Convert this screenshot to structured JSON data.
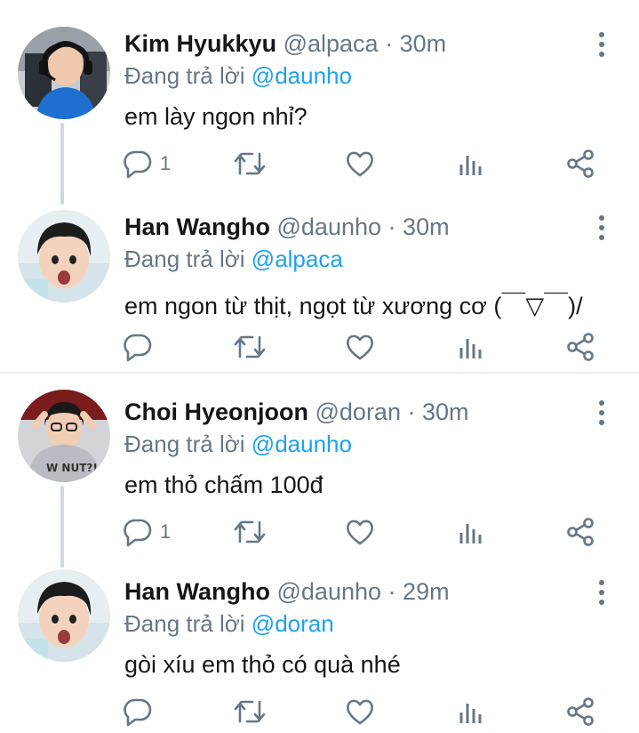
{
  "tweets": [
    {
      "name": "Kim Hyukkyu",
      "handle": "@alpaca",
      "time": "30m",
      "reply_prefix": "Đang trả lời",
      "reply_to": "@daunho",
      "text": "em lày ngon nhỉ?",
      "reply_count": "1",
      "avatar": "avatar-kim-hyukkyu"
    },
    {
      "name": "Han Wangho",
      "handle": "@daunho",
      "time": "30m",
      "reply_prefix": "Đang trả lời",
      "reply_to": "@alpaca",
      "text": "em ngon từ thịt, ngọt từ xương cơ (￣▽￣)/",
      "reply_count": "",
      "avatar": "avatar-han-wangho"
    },
    {
      "name": "Choi Hyeonjoon",
      "handle": "@doran",
      "time": "30m",
      "reply_prefix": "Đang trả lời",
      "reply_to": "@daunho",
      "text": "em thỏ chấm 100đ",
      "reply_count": "1",
      "avatar": "avatar-choi-hyeonjoon"
    },
    {
      "name": "Han Wangho",
      "handle": "@daunho",
      "time": "29m",
      "reply_prefix": "Đang trả lời",
      "reply_to": "@doran",
      "text": "gòi xíu em thỏ có quà nhé",
      "reply_count": "",
      "avatar": "avatar-han-wangho"
    }
  ],
  "separator": "·",
  "icons": {
    "reply": "reply-icon",
    "retweet": "retweet-icon",
    "like": "heart-icon",
    "analytics": "analytics-icon",
    "share": "share-icon",
    "more": "more-options-icon"
  },
  "colors": {
    "accent": "#1da1f2",
    "secondary_text": "#657786",
    "primary_text": "#14171a",
    "thread_line": "#cfd9de",
    "divider": "#e6ecf0"
  }
}
